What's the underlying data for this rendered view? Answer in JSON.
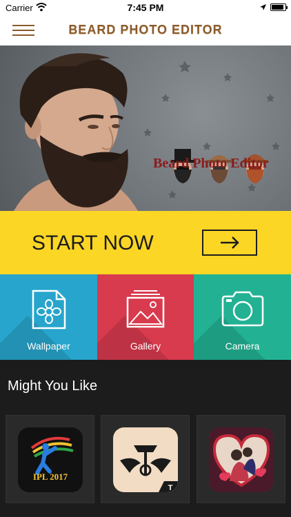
{
  "status_bar": {
    "carrier": "Carrier",
    "time": "7:45 PM",
    "battery_level": 0.9
  },
  "app_bar": {
    "title": "BEARD PHOTO EDITOR",
    "menu_icon": "hamburger-menu-icon"
  },
  "banner": {
    "caption": "Beard Photo Editor"
  },
  "start": {
    "label": "START NOW",
    "icon": "arrow-right-icon"
  },
  "tiles": [
    {
      "label": "Wallpaper",
      "icon": "wallpaper-flower-icon",
      "color": "#27a5cc"
    },
    {
      "label": "Gallery",
      "icon": "gallery-image-icon",
      "color": "#d83a4e"
    },
    {
      "label": "Camera",
      "icon": "camera-icon",
      "color": "#22b293"
    }
  ],
  "might_like": {
    "title": "Might You Like",
    "apps": [
      {
        "icon": "ipl-cricket-app-icon",
        "text": "IPL 2017"
      },
      {
        "icon": "tattoo-app-icon",
        "badge": "T"
      },
      {
        "icon": "love-photo-frame-app-icon"
      }
    ]
  },
  "colors": {
    "brand_brown": "#8a5a2b",
    "start_yellow": "#fbd625",
    "background": "#1c1c1c"
  }
}
